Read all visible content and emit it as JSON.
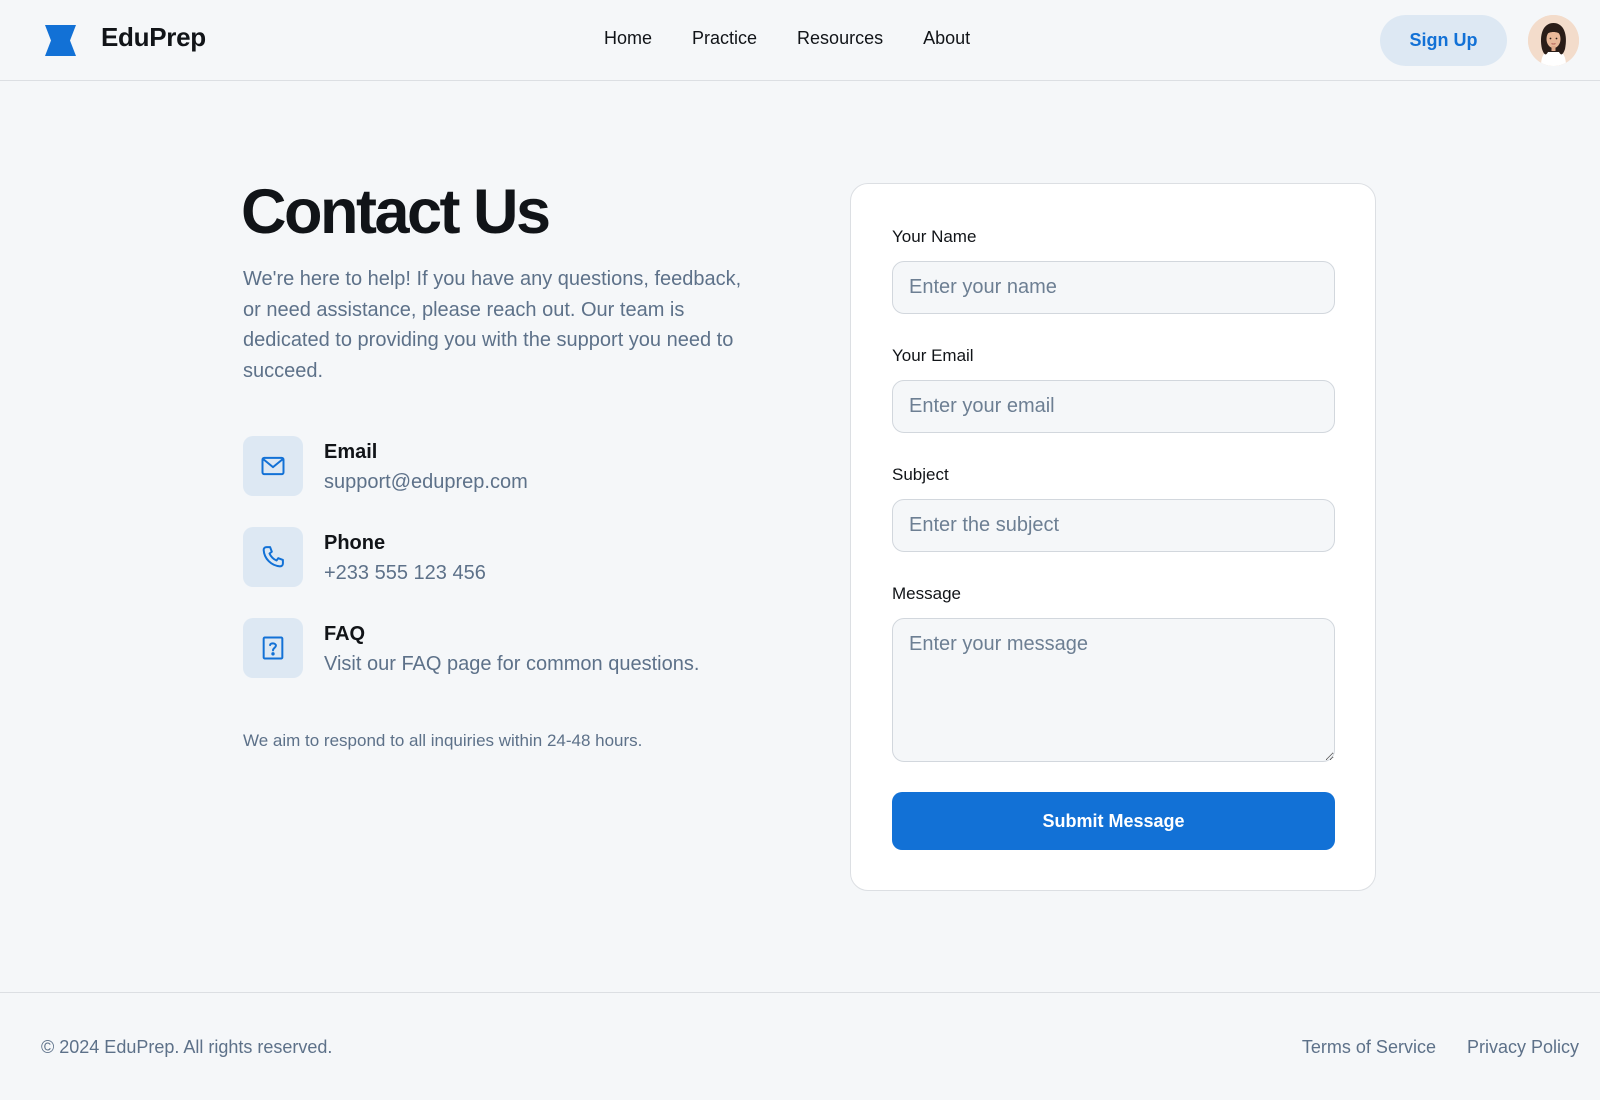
{
  "brand": {
    "name": "EduPrep",
    "logo_icon": "bowtie-logo-icon",
    "accent_color": "#1271d6"
  },
  "nav": {
    "items": [
      {
        "label": "Home"
      },
      {
        "label": "Practice"
      },
      {
        "label": "Resources"
      },
      {
        "label": "About"
      }
    ]
  },
  "header": {
    "signup_label": "Sign Up",
    "avatar_icon": "user-avatar"
  },
  "main": {
    "title": "Contact Us",
    "intro": "We're here to help! If you have any questions, feedback, or need assistance, please reach out. Our team is dedicated to providing you with the support you need to succeed.",
    "contacts": [
      {
        "icon": "mail-icon",
        "label": "Email",
        "value": "support@eduprep.com"
      },
      {
        "icon": "phone-icon",
        "label": "Phone",
        "value": "+233 555 123 456"
      },
      {
        "icon": "help-icon",
        "label": "FAQ",
        "value": "Visit our FAQ page for common questions."
      }
    ],
    "response_note": "We aim to respond to all inquiries within 24-48 hours."
  },
  "form": {
    "name": {
      "label": "Your Name",
      "placeholder": "Enter your name",
      "value": ""
    },
    "email": {
      "label": "Your Email",
      "placeholder": "Enter your email",
      "value": ""
    },
    "subject": {
      "label": "Subject",
      "placeholder": "Enter the subject",
      "value": ""
    },
    "message": {
      "label": "Message",
      "placeholder": "Enter your message",
      "value": ""
    },
    "submit_label": "Submit Message"
  },
  "footer": {
    "copyright": "© 2024 EduPrep. All rights reserved.",
    "links": [
      {
        "label": "Terms of Service"
      },
      {
        "label": "Privacy Policy"
      }
    ]
  }
}
